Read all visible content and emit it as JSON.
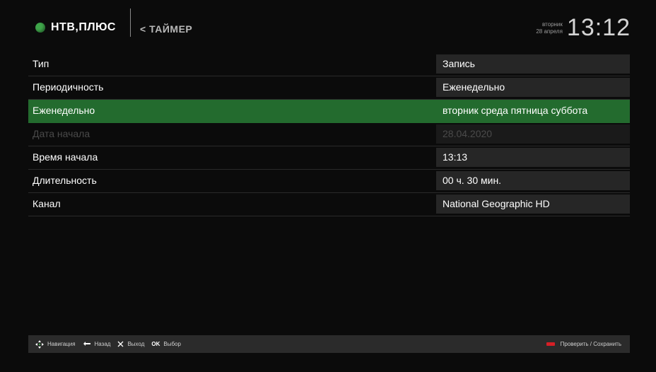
{
  "header": {
    "brand": "НТВ,ПЛЮС",
    "back_label": "< ТАЙМЕР",
    "weekday": "вторник",
    "date": "28 апреля",
    "time": "13:12",
    "brand_color": "#3fa54a"
  },
  "rows": [
    {
      "label": "Тип",
      "value": "Запись"
    },
    {
      "label": "Периодичность",
      "value": "Еженедельно"
    },
    {
      "label": "Еженедельно",
      "value": "вторник среда пятница суббота"
    },
    {
      "label": "Дата начала",
      "value": "28.04.2020"
    },
    {
      "label": "Время начала",
      "value": "13:13"
    },
    {
      "label": "Длительность",
      "value": "00 ч. 30 мин."
    },
    {
      "label": "Канал",
      "value": "National Geographic HD"
    }
  ],
  "selected_row": "Еженедельно",
  "disabled_row": "Дата начала",
  "footer": {
    "nav": "Навигация",
    "back": "Назад",
    "exit": "Выход",
    "ok_key": "OK",
    "select": "Выбор",
    "save": "Проверить / Сохранить"
  },
  "icons": {
    "nav": "dpad-icon",
    "back": "back-arrow-icon",
    "exit": "x-icon",
    "save": "red-button-icon"
  },
  "colors": {
    "selected_row": "#236b2e",
    "value_cell": "#262626",
    "save_key": "#d51f26"
  }
}
